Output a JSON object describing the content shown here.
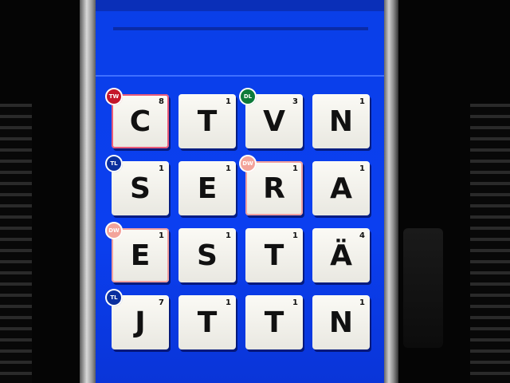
{
  "colors": {
    "screen_blue": "#0b3ff0",
    "tile_face": "#f7f6f0",
    "badge_tw": "#c4162a",
    "badge_dl": "#0d7a3a",
    "badge_tl": "#0a2f9e",
    "badge_dw": "#f3a39a"
  },
  "board": {
    "rows": [
      [
        {
          "letter": "C",
          "points": "8",
          "badge": "TW",
          "badge_color": "#c4162a"
        },
        {
          "letter": "T",
          "points": "1"
        },
        {
          "letter": "V",
          "points": "3",
          "badge": "DL",
          "badge_color": "#0d7a3a"
        },
        {
          "letter": "N",
          "points": "1"
        }
      ],
      [
        {
          "letter": "S",
          "points": "1",
          "badge": "TL",
          "badge_color": "#0a2f9e"
        },
        {
          "letter": "E",
          "points": "1"
        },
        {
          "letter": "R",
          "points": "1",
          "badge": "DW",
          "badge_color": "#f3a39a"
        },
        {
          "letter": "A",
          "points": "1"
        }
      ],
      [
        {
          "letter": "E",
          "points": "1",
          "badge": "DW",
          "badge_color": "#f3a39a"
        },
        {
          "letter": "S",
          "points": "1"
        },
        {
          "letter": "T",
          "points": "1"
        },
        {
          "letter": "Ä",
          "points": "4"
        }
      ],
      [
        {
          "letter": "J",
          "points": "7",
          "badge": "TL",
          "badge_color": "#0a2f9e"
        },
        {
          "letter": "T",
          "points": "1"
        },
        {
          "letter": "T",
          "points": "1"
        },
        {
          "letter": "N",
          "points": "1"
        }
      ]
    ]
  }
}
